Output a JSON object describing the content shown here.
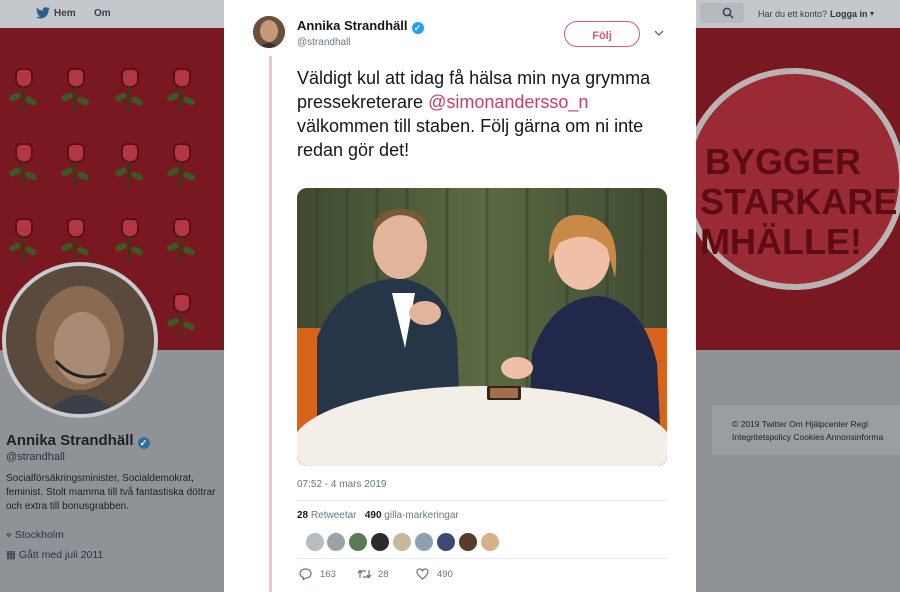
{
  "background": {
    "nav": {
      "home_label": "Hem",
      "about_label": "Om",
      "account_prompt": "Har du ett konto?",
      "login_label": "Logga in"
    },
    "banner_text": [
      "BYGGER",
      "STARKARE",
      "MHÄLLE!"
    ],
    "profile": {
      "name": "Annika Strandhäll",
      "handle": "@strandhall",
      "bio": "Socialförsäkringsminister, Socialdemokrat, feminist. Stolt mamma till två fantastiska döttrar och extra till bonusgrabben.",
      "location": "Stockholm",
      "joined": "Gått med juli 2011"
    },
    "footer": {
      "line1": "© 2019 Twitter   Om   Hjälpcenter   Regl",
      "line2": "Integritetspolicy   Cookies   Annonsinforma"
    }
  },
  "tweet": {
    "author_name": "Annika Strandhäll",
    "author_handle": "@strandhall",
    "follow_label": "Följ",
    "text_before": "Väldigt kul att idag få hälsa min  nya grymma pressekreterare ",
    "mention": "@simonandersso_n",
    "text_after": " välkommen till staben. Följ gärna om ni inte redan gör det!",
    "timestamp": "07:52 - 4 mars 2019",
    "retweets_count": "28",
    "retweets_label": "Retweetar",
    "likes_count": "490",
    "likes_label": "gilla-markeringar",
    "actions": {
      "replies": "163",
      "retweets": "28",
      "likes": "490"
    }
  },
  "colors": {
    "accent": "#d75a7c",
    "mention": "#c4406a",
    "thread_line": "#f0c3d0",
    "verified": "#1da1f2"
  }
}
